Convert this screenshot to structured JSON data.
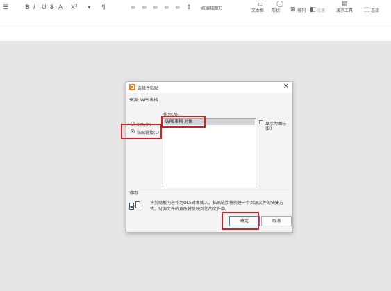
{
  "ribbon": {
    "textbox": "文本框",
    "shape": "形状",
    "arrange": "排列",
    "reflow": "段落",
    "tools": "演示工具",
    "more": "选择",
    "paste_mode": "统编辑图形"
  },
  "dialog": {
    "title": "选择性粘贴",
    "close": "✕",
    "source_label": "来源:",
    "source_value": "WPS表格",
    "as_label": "作为(A):",
    "paste_label": "粘贴(P)",
    "paste_link_label": "粘贴链接(L)",
    "list_items": [
      "WPS表格 对象"
    ],
    "display_icon_label": "显示为图标(D)",
    "result_label": "说明",
    "result_text": "将剪贴板内容作为OLE对象插入。粘贴链接将创建一个到源文件的快捷方式。对源文件的更改将反映到您的文件中。",
    "ok": "确定",
    "cancel": "取消"
  },
  "colors": {
    "annotation": "#d42020",
    "app_icon": "#f07b22",
    "selection": "#cfd3da"
  }
}
